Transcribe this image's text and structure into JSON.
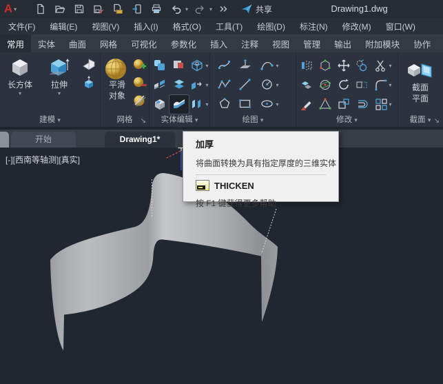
{
  "title_bar": {
    "app_logo": "A",
    "title": "Drawing1.dwg",
    "share_label": "共享",
    "qat_icons": [
      "new-file-icon",
      "open-folder-icon",
      "save-icon",
      "save-as-icon",
      "file-folder-icon",
      "mobile-transfer-icon",
      "print-icon",
      "undo-icon",
      "redo-icon",
      "more-chevrons-icon",
      "share-plane-icon"
    ]
  },
  "menu_bar": {
    "items": [
      "文件(F)",
      "编辑(E)",
      "视图(V)",
      "插入(I)",
      "格式(O)",
      "工具(T)",
      "绘图(D)",
      "标注(N)",
      "修改(M)",
      "窗口(W)"
    ]
  },
  "ribbon": {
    "active_tab": "常用",
    "tabs": [
      "常用",
      "实体",
      "曲面",
      "网格",
      "可视化",
      "参数化",
      "插入",
      "注释",
      "视图",
      "管理",
      "输出",
      "附加模块",
      "协作"
    ],
    "panels": [
      {
        "label": "建模",
        "buttons": [
          {
            "label": "长方体",
            "icon": "box-icon"
          },
          {
            "label": "拉伸",
            "icon": "extrude-icon"
          }
        ],
        "small_icons": [
          "polysolid-icon",
          "presspull-icon"
        ]
      },
      {
        "label": "网格",
        "button": {
          "label_line1": "平滑",
          "label_line2": "对象",
          "icon": "smooth-object-icon"
        },
        "small_icons": [
          "mesh-refine-add-icon",
          "mesh-refine-remove-icon",
          "mesh-no-smooth-icon"
        ]
      },
      {
        "label": "实体编辑",
        "icons": [
          "union-icon",
          "subtract-icon",
          "solid-edit-cube-icon",
          "slice-icon",
          "separate-icon",
          "extrude-faces-icon",
          "imprint-icon",
          "thicken-icon",
          "offset-edges-icon"
        ],
        "highlighted_icon": "thicken-icon"
      },
      {
        "label": "绘图",
        "icons": [
          "spline-icon",
          "surface-patch-icon",
          "arc-icon",
          "polyline-icon",
          "line-icon",
          "circle-icon",
          "polygon-icon",
          "rectangle-icon",
          "ellipse-icon"
        ]
      },
      {
        "label": "修改",
        "icons": [
          "mirror-icon",
          "align-3d-icon",
          "move-icon",
          "copy-icon",
          "trim-icon",
          "slice-solid-icon",
          "rotate-3d-icon",
          "rotate-icon",
          "stretch-icon",
          "fillet-icon",
          "erase-icon",
          "scale-icon",
          "rect-handle-icon",
          "offset-icon",
          "array-icon"
        ]
      },
      {
        "label": "截面",
        "button": {
          "label_line1": "截面",
          "label_line2": "平面",
          "icon": "section-plane-icon"
        }
      }
    ]
  },
  "file_tabs": {
    "tabs": [
      {
        "label": "开始",
        "active": false
      },
      {
        "label": "Drawing1*",
        "active": true
      }
    ]
  },
  "tooltip": {
    "title": "加厚",
    "description": "将曲面转换为具有指定厚度的三维实体",
    "command": "THICKEN",
    "command_icon": "command-window-icon",
    "help": "按 F1 键获得更多帮助"
  },
  "viewport": {
    "label": "[-][西南等轴测][真实]",
    "content": "gray S-shaped extruded surface in SW isometric view",
    "cursor": "3d-crosshair"
  },
  "icons": {
    "dropdown": "▾",
    "launcher": "↘"
  },
  "colors": {
    "viewport_bg": "#212731",
    "ribbon_bg": "#2d333e",
    "tabs_bg": "#333a44",
    "titlebar_bg": "#262b34",
    "accent_blue": "#4da0d8",
    "tooltip_bg": "#f1f1f2",
    "surface_gray": "#b0b2b4",
    "logo_red": "#c5302e"
  }
}
